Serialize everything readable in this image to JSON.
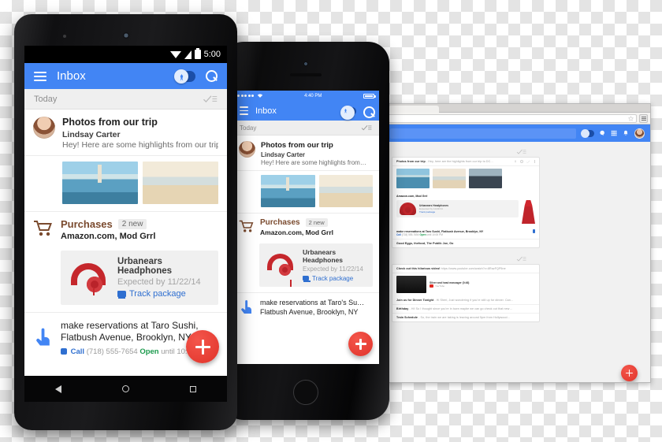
{
  "android": {
    "status": {
      "time": "5:00",
      "wifi_icon": "wifi-icon",
      "signal_icon": "signal-icon",
      "battery_icon": "battery-icon"
    },
    "appbar": {
      "menu_icon": "hamburger-menu-icon",
      "title": "Inbox",
      "toggle_icon": "pin-toggle",
      "search_icon": "search-icon"
    },
    "today": {
      "label": "Today",
      "sweep_icon": "sweep-icon"
    },
    "mail": {
      "subject": "Photos from our trip",
      "sender": "Lindsay Carter",
      "snippet": "Hey! Here are some highlights from our trip…"
    },
    "bundle": {
      "name": "Purchases",
      "badge": "2 new",
      "senders": "Amazon.com, Mod Grrl",
      "icon": "shopping-cart-icon"
    },
    "product": {
      "name": "Urbanears Headphones",
      "expected": "Expected by 11/22/14",
      "track": "Track package",
      "truck_icon": "delivery-truck-icon"
    },
    "reminder": {
      "line1": "make reservations at Taro Sushi,",
      "line2": "Flatbush Avenue, Brooklyn, NY",
      "call_label": "Call",
      "phone": "(718) 555-7654",
      "open_label": "Open",
      "open_until": "until 10:00 PM",
      "icon": "pointing-hand-icon"
    },
    "fab": {
      "icon": "plus-icon"
    },
    "navbar": {
      "back": "back-icon",
      "home": "home-icon",
      "recents": "recents-icon"
    }
  },
  "iphone": {
    "status": {
      "time": "4:40 PM",
      "signal_icon": "dots-signal-icon",
      "wifi_icon": "wifi-icon",
      "battery_icon": "battery-icon"
    },
    "appbar": {
      "menu_icon": "hamburger-menu-icon",
      "title": "Inbox",
      "toggle_icon": "pin-toggle",
      "search_icon": "search-icon"
    },
    "today": {
      "label": "Today",
      "sweep_icon": "sweep-icon"
    },
    "mail": {
      "subject": "Photos from our trip",
      "sender": "Lindsay Carter",
      "snippet": "Hey! Here are some highlights from…"
    },
    "bundle": {
      "name": "Purchases",
      "badge": "2 new",
      "senders": "Amazon.com, Mod Grrl",
      "icon": "shopping-cart-icon"
    },
    "product": {
      "name": "Urbanears Headphones",
      "expected": "Expected by 11/22/14",
      "track": "Track package",
      "truck_icon": "delivery-truck-icon"
    },
    "reminder": {
      "line1": "make reservations at Taro's Su…",
      "line2": "Flatbush Avenue, Brooklyn, NY",
      "icon": "pointing-hand-icon"
    },
    "fab": {
      "icon": "plus-icon"
    }
  },
  "desktop": {
    "browser": {
      "star_icon": "bookmark-star-icon",
      "menu_icon": "browser-menu-icon"
    },
    "appbar": {
      "toggle_icon": "pin-toggle",
      "icons": [
        "hangouts-icon",
        "apps-grid-icon",
        "notifications-bell-icon"
      ],
      "avatar": "user-avatar"
    },
    "today": {
      "sweep_icon": "sweep-icon"
    },
    "mail": {
      "subject": "Photos from our trip",
      "snippet": "- Hey, here are the highlights from our trip to DC…",
      "actions": [
        "pin-icon",
        "snooze-icon",
        "done-icon",
        "more-icon"
      ]
    },
    "bundle": {
      "senders": "Amazon.com, Mod Grrl"
    },
    "product": {
      "name": "Urbanears Headphones",
      "expected": "Expected by 11/22/14",
      "track": "Track package"
    },
    "reminder": {
      "text": "make reservations at Taro Sushi, Flatbush Avenue, Brooklyn, NY",
      "call_label": "Call",
      "phone": "(718) 555-7654",
      "open_label": "Open",
      "open_until": "until 10:00 PM"
    },
    "bundle2": {
      "senders": "Good Eggs, thefood, The Publik Joe, Go"
    },
    "video_mail": {
      "subject": "Check out this hilarious video!",
      "url": "https://www.youtube.com/watch?v=8RazFQP5ne",
      "card_title": "Silver and head massager (0:46)",
      "source": "YouTube"
    },
    "rows": [
      {
        "subject": "Join us for Dinner Tonight",
        "snippet": "- Hi Sheri, Just wondering if you're still up for dinner. Can…"
      },
      {
        "subject": "Birthday",
        "snippet": "- Hi! So I thought since you're in town maybe we can go check out that new…"
      },
      {
        "subject": "Train Schedule",
        "snippet": "- So, the train we are taking is leaving around 5pm from Hollywood…"
      }
    ],
    "fab": {
      "icon": "plus-icon"
    }
  }
}
